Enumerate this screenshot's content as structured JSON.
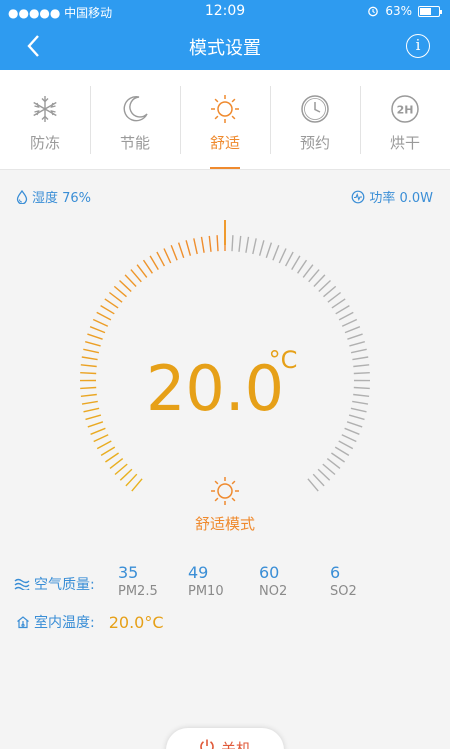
{
  "status": {
    "signal": "●●●●● 中国移动",
    "wifi": "wifi-icon",
    "time": "12:09",
    "battery": "63%",
    "battery_level": 0.63
  },
  "header": {
    "title": "模式设置",
    "info_label": "i"
  },
  "tabs": [
    {
      "label": "防冻",
      "icon": "snowflake-icon",
      "active": false
    },
    {
      "label": "节能",
      "icon": "moon-icon",
      "active": false
    },
    {
      "label": "舒适",
      "icon": "sun-icon",
      "active": true
    },
    {
      "label": "预约",
      "icon": "clock-icon",
      "active": false
    },
    {
      "label": "烘干",
      "icon": "2h-icon",
      "icon_text": "2H",
      "active": false
    }
  ],
  "humidity": {
    "label": "湿度 76%"
  },
  "power": {
    "label": "功率 0.0W"
  },
  "dial": {
    "temperature": "20.0",
    "unit": "°C",
    "mode_label": "舒适模式",
    "level": 0.5
  },
  "air_quality": {
    "label": "空气质量:",
    "items": [
      {
        "value": "35",
        "name": "PM2.5"
      },
      {
        "value": "49",
        "name": "PM10"
      },
      {
        "value": "60",
        "name": "NO2"
      },
      {
        "value": "6",
        "name": "SO2"
      }
    ]
  },
  "indoor": {
    "label": "室内温度:",
    "value": "20.0°C"
  },
  "power_button": {
    "label": "关机"
  },
  "colors": {
    "accent": "#2e9bf0",
    "orange": "#ef8a2e",
    "gold": "#e6a018",
    "blue_text": "#3a8ed6",
    "gray_tick": "#b0b0b0"
  }
}
